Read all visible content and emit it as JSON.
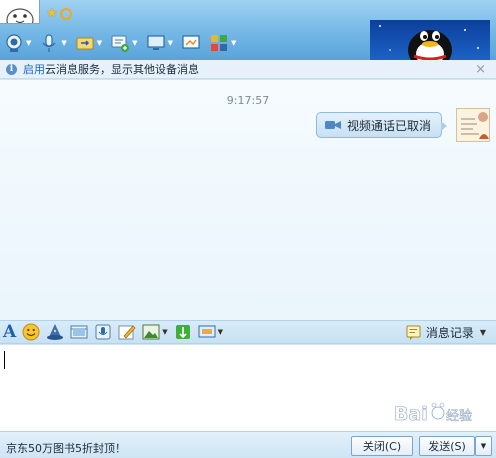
{
  "header": {
    "toolbar_items": [
      {
        "icon": "webcam-icon",
        "has_dropdown": true
      },
      {
        "icon": "microphone-icon",
        "has_dropdown": true
      },
      {
        "icon": "file-transfer-icon",
        "has_dropdown": true
      },
      {
        "icon": "add-message-icon",
        "has_dropdown": true
      },
      {
        "icon": "remote-desktop-icon",
        "has_dropdown": true
      },
      {
        "icon": "screen-share-icon",
        "has_dropdown": false
      },
      {
        "icon": "apps-grid-icon",
        "has_dropdown": true
      }
    ]
  },
  "notice": {
    "link": "启用",
    "text": "云消息服务，显示其他设备消息",
    "close": "×"
  },
  "chat": {
    "time": "9:17:57",
    "message": "视频通话已取消"
  },
  "input_toolbar": {
    "font_label": "A",
    "history_label": "消息记录"
  },
  "bottom": {
    "ad_text": "京东50万图书5折封顶！",
    "close_button": "关闭(C)",
    "send_button": "发送(S)"
  },
  "colors": {
    "header_top": "#9fd2f2",
    "header_bottom": "#5aa3da",
    "link": "#1e68c0",
    "bubble_border": "#8fb9dc"
  }
}
